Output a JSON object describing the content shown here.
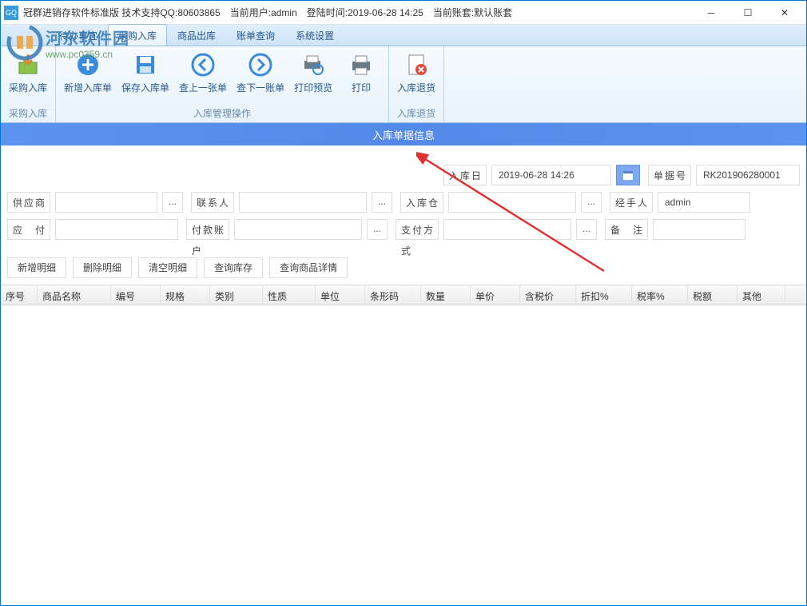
{
  "title": {
    "app": "冠群进销存软件标准版 技术支持QQ:80603865",
    "user_label": "当前用户:",
    "user": "admin",
    "login_label": "登陆时间:",
    "login_time": "2019-06-28 14:25",
    "ledger_label": "当前账套:",
    "ledger": "默认账套"
  },
  "watermark": {
    "line1": "河东软件园",
    "line2": "www.pc0359.cn"
  },
  "tabs": [
    "待办事宜",
    "采购入库",
    "商品出库",
    "账单查询",
    "系统设置"
  ],
  "ribbon": {
    "groups": [
      {
        "label": "采购入库",
        "items": [
          "采购入库"
        ]
      },
      {
        "label": "入库管理操作",
        "items": [
          "新增入库单",
          "保存入库单",
          "查上一张单",
          "查下一账单",
          "打印预览",
          "打印"
        ]
      },
      {
        "label": "入库退货",
        "items": [
          "入库退货"
        ]
      }
    ]
  },
  "section_title": "入库单据信息",
  "form": {
    "row1": {
      "date_label": "入库日期",
      "date_value": "2019-06-28 14:26",
      "docno_label": "单据号",
      "docno_value": "RK201906280001"
    },
    "row2": {
      "supplier_label": "供应商",
      "contact_label": "联系人",
      "warehouse_label": "入库仓库",
      "handler_label": "经手人",
      "handler_value": "admin"
    },
    "row3": {
      "pay_label": "应　付",
      "account_label": "付款账户",
      "paymode_label": "支付方式",
      "remark_label": "备　注"
    }
  },
  "toolbar": [
    "新增明细",
    "删除明细",
    "清空明细",
    "查询库存",
    "查询商品详情"
  ],
  "grid_cols": [
    "序号",
    "商品名称",
    "编号",
    "规格",
    "类别",
    "性质",
    "单位",
    "条形码",
    "数量",
    "单价",
    "含税价",
    "折扣%",
    "税率%",
    "税额",
    "其他"
  ]
}
